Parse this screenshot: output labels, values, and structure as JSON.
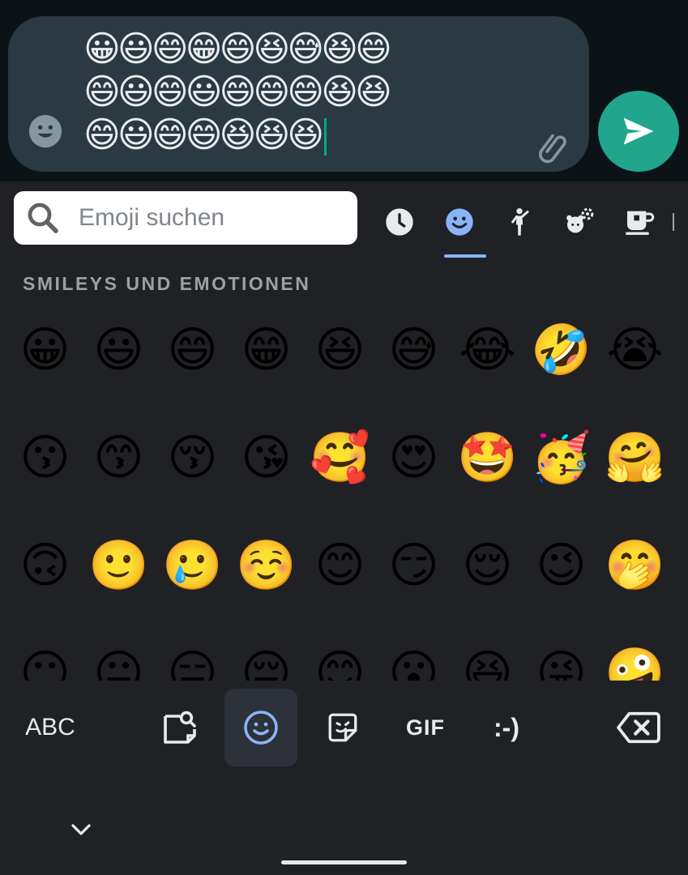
{
  "composer": {
    "message_lines": [
      "😀😃😄😁😄😆😅😆😄",
      "😄😃😄😃😄😄😄😆😆",
      "😄😃😄😄😆😆😆"
    ],
    "emoji_button_icon": "smiley-icon",
    "attach_icon": "paperclip-icon",
    "send_icon": "send-icon"
  },
  "keyboard": {
    "search": {
      "placeholder": "Emoji suchen",
      "value": ""
    },
    "category_tabs": [
      {
        "name": "recent",
        "icon": "clock-icon"
      },
      {
        "name": "smileys",
        "icon": "smiley-icon",
        "active": true
      },
      {
        "name": "people",
        "icon": "person-icon"
      },
      {
        "name": "animals-nature",
        "icon": "bear-flower-icon"
      },
      {
        "name": "food-drink",
        "icon": "cup-icon"
      }
    ],
    "section_title": "SMILEYS UND EMOTIONEN",
    "emoji_rows": [
      [
        "😀",
        "😃",
        "😄",
        "😁",
        "😆",
        "😅",
        "😂",
        "🤣",
        "😭"
      ],
      [
        "😗",
        "😙",
        "😚",
        "😘",
        "🥰",
        "😍",
        "🤩",
        "🥳",
        "🤗"
      ],
      [
        "🙃",
        "🙂",
        "🥲",
        "☺️",
        "😊",
        "😏",
        "😌",
        "😉",
        "🤭"
      ],
      [
        "😶",
        "😐",
        "😑",
        "😔",
        "😊",
        "😮",
        "😆",
        "😜",
        "🤪"
      ]
    ],
    "toolbar": {
      "abc_label": "ABC",
      "gif_label": "GIF",
      "emoticon_label": ":-)"
    }
  },
  "colors": {
    "accent": "#8ab4f8",
    "send_button": "#21a68d",
    "caret": "#00a884",
    "composer_bg": "#2a3942",
    "keyboard_bg": "#202124"
  }
}
